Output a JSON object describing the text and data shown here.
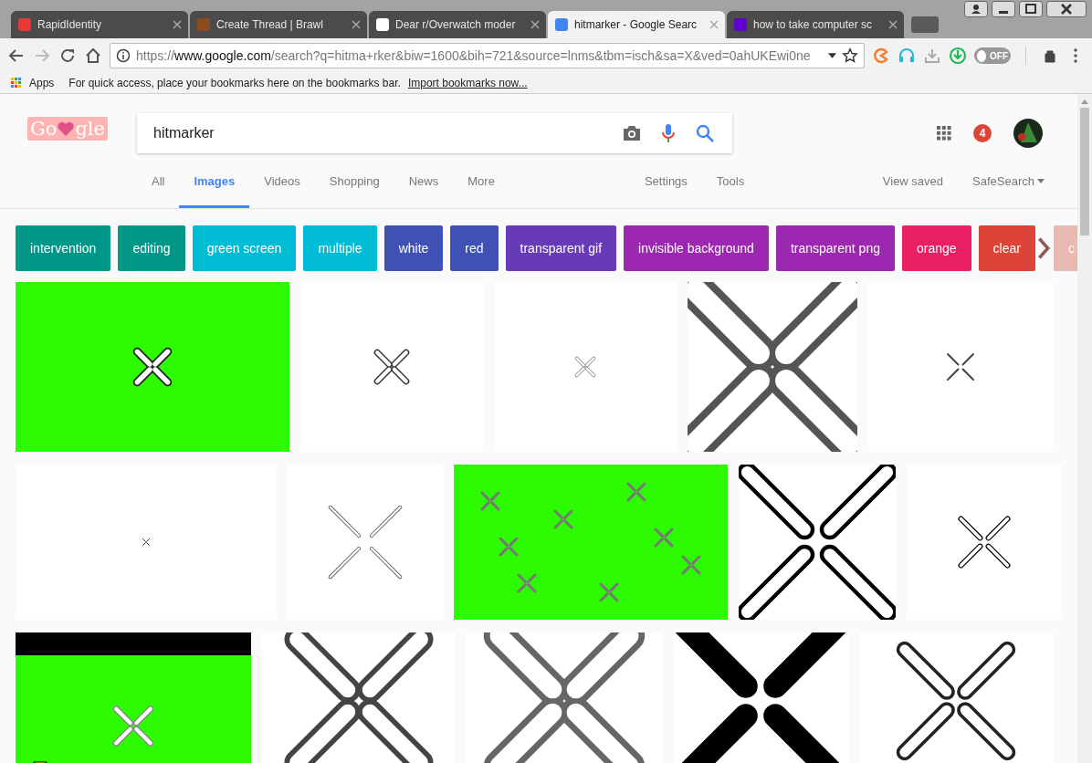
{
  "browser_tabs": [
    {
      "title": "RapidIdentity",
      "selected": false
    },
    {
      "title": "Create Thread | Brawl",
      "selected": false
    },
    {
      "title": "Dear r/Overwatch moder",
      "selected": false
    },
    {
      "title": "hitmarker - Google Searc",
      "selected": true
    },
    {
      "title": "how to take computer sc",
      "selected": false
    }
  ],
  "address_bar": {
    "scheme": "https://",
    "host": "www.google.com",
    "path": "/search?q=hitma+rker&biw=1600&bih=721&source=lnms&tbm=isch&sa=X&ved=0ahUKEwi0ne"
  },
  "extension_toggle": {
    "label": "OFF",
    "on": false
  },
  "bookmarks_bar": {
    "apps": "Apps",
    "message": "For quick access, place your bookmarks here on the bookmarks bar.",
    "link": "Import bookmarks now..."
  },
  "logo": {
    "before": "Go",
    "after": "gle"
  },
  "search": {
    "value": "hitmarker"
  },
  "notifications": "4",
  "search_tabs": [
    {
      "label": "All",
      "selected": false
    },
    {
      "label": "Images",
      "selected": true
    },
    {
      "label": "Videos",
      "selected": false
    },
    {
      "label": "Shopping",
      "selected": false
    },
    {
      "label": "News",
      "selected": false
    },
    {
      "label": "More",
      "selected": false
    }
  ],
  "tools": [
    "Settings",
    "Tools"
  ],
  "view_saved": "View saved",
  "safesearch": "SafeSearch",
  "chips": [
    {
      "label": "intervention",
      "color": "#009688"
    },
    {
      "label": "editing",
      "color": "#009688"
    },
    {
      "label": "green screen",
      "color": "#00bcd4"
    },
    {
      "label": "multiple",
      "color": "#00bcd4"
    },
    {
      "label": "white",
      "color": "#3f51b5"
    },
    {
      "label": "red",
      "color": "#3f51b5"
    },
    {
      "label": "transparent gif",
      "color": "#673ab7"
    },
    {
      "label": "invisible background",
      "color": "#9c27b0"
    },
    {
      "label": "transparent png",
      "color": "#9c27b0"
    },
    {
      "label": "orange",
      "color": "#e91e63"
    },
    {
      "label": "clear",
      "color": "#db4437"
    },
    {
      "label": "c",
      "color": "#e8b9b0"
    }
  ],
  "results": [
    [
      {
        "kind": "picture"
      },
      {
        "kind": "picture"
      },
      {
        "kind": "picture"
      },
      {
        "kind": "picture"
      },
      {
        "kind": "picture"
      }
    ],
    [
      {
        "kind": "picture"
      },
      {
        "kind": "picture"
      },
      {
        "kind": "picture"
      },
      {
        "kind": "picture"
      },
      {
        "kind": "picture"
      }
    ],
    [
      {
        "kind": "picture"
      },
      {
        "kind": "picture"
      },
      {
        "kind": "picture"
      },
      {
        "kind": "picture"
      },
      {
        "kind": "picture"
      }
    ]
  ]
}
